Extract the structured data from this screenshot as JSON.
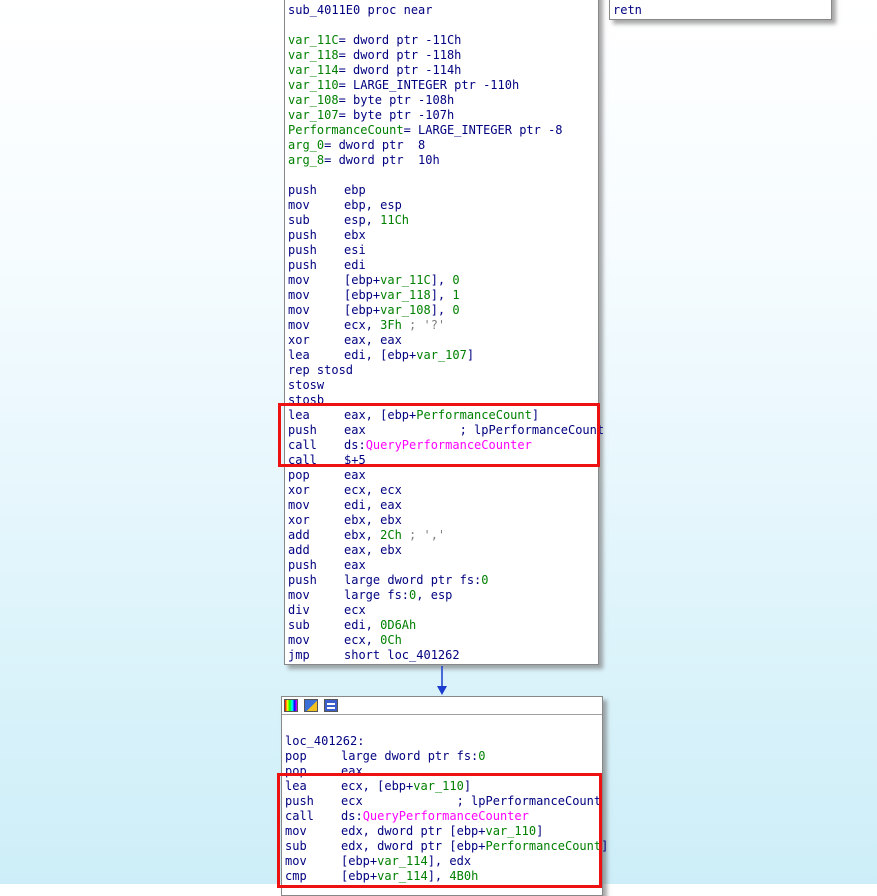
{
  "side_node": {
    "lines": [
      {
        "mnem": "retn",
        "ops": ""
      }
    ]
  },
  "main_node": {
    "header_label": "sub_4011E0 proc near",
    "vars": [
      {
        "name": "var_11C",
        "def": "= dword ptr -11Ch"
      },
      {
        "name": "var_118",
        "def": "= dword ptr -118h"
      },
      {
        "name": "var_114",
        "def": "= dword ptr -114h"
      },
      {
        "name": "var_110",
        "def": "= LARGE_INTEGER ptr -110h"
      },
      {
        "name": "var_108",
        "def": "= byte ptr -108h"
      },
      {
        "name": "var_107",
        "def": "= byte ptr -107h"
      },
      {
        "name": "PerformanceCount",
        "def": "= LARGE_INTEGER ptr -8"
      },
      {
        "name": "arg_0",
        "def": "= dword ptr  8"
      },
      {
        "name": "arg_8",
        "def": "= dword ptr  10h"
      }
    ],
    "instructions": [
      {
        "mnem": "push",
        "parts": [
          {
            "t": "ebp",
            "c": "blu"
          }
        ]
      },
      {
        "mnem": "mov",
        "parts": [
          {
            "t": "ebp, esp",
            "c": "blu"
          }
        ]
      },
      {
        "mnem": "sub",
        "parts": [
          {
            "t": "esp, ",
            "c": "blu"
          },
          {
            "t": "11Ch",
            "c": "grn"
          }
        ]
      },
      {
        "mnem": "push",
        "parts": [
          {
            "t": "ebx",
            "c": "blu"
          }
        ]
      },
      {
        "mnem": "push",
        "parts": [
          {
            "t": "esi",
            "c": "blu"
          }
        ]
      },
      {
        "mnem": "push",
        "parts": [
          {
            "t": "edi",
            "c": "blu"
          }
        ]
      },
      {
        "mnem": "mov",
        "parts": [
          {
            "t": "[ebp+",
            "c": "blu"
          },
          {
            "t": "var_11C",
            "c": "grn"
          },
          {
            "t": "], ",
            "c": "blu"
          },
          {
            "t": "0",
            "c": "grn"
          }
        ]
      },
      {
        "mnem": "mov",
        "parts": [
          {
            "t": "[ebp+",
            "c": "blu"
          },
          {
            "t": "var_118",
            "c": "grn"
          },
          {
            "t": "], ",
            "c": "blu"
          },
          {
            "t": "1",
            "c": "grn"
          }
        ]
      },
      {
        "mnem": "mov",
        "parts": [
          {
            "t": "[ebp+",
            "c": "blu"
          },
          {
            "t": "var_108",
            "c": "grn"
          },
          {
            "t": "], ",
            "c": "blu"
          },
          {
            "t": "0",
            "c": "grn"
          }
        ]
      },
      {
        "mnem": "mov",
        "parts": [
          {
            "t": "ecx, ",
            "c": "blu"
          },
          {
            "t": "3Fh",
            "c": "grn"
          },
          {
            "t": " ; '?'",
            "c": "gry"
          }
        ]
      },
      {
        "mnem": "xor",
        "parts": [
          {
            "t": "eax, eax",
            "c": "blu"
          }
        ]
      },
      {
        "mnem": "lea",
        "parts": [
          {
            "t": "edi, [ebp+",
            "c": "blu"
          },
          {
            "t": "var_107",
            "c": "grn"
          },
          {
            "t": "]",
            "c": "blu"
          }
        ]
      },
      {
        "mnem": "rep stosd",
        "parts": []
      },
      {
        "mnem": "stosw",
        "parts": []
      },
      {
        "mnem": "stosb",
        "parts": []
      },
      {
        "mnem": "lea",
        "parts": [
          {
            "t": "eax, [ebp+",
            "c": "blu"
          },
          {
            "t": "PerformanceCount",
            "c": "grn"
          },
          {
            "t": "]",
            "c": "blu"
          }
        ]
      },
      {
        "mnem": "push",
        "parts": [
          {
            "t": "eax             ; lpPerformanceCount",
            "c": "blu"
          }
        ]
      },
      {
        "mnem": "call",
        "parts": [
          {
            "t": "ds:",
            "c": "blu"
          },
          {
            "t": "QueryPerformanceCounter",
            "c": "mag"
          }
        ]
      },
      {
        "mnem": "call",
        "parts": [
          {
            "t": "$+5",
            "c": "blu"
          }
        ]
      },
      {
        "mnem": "pop",
        "parts": [
          {
            "t": "eax",
            "c": "blu"
          }
        ]
      },
      {
        "mnem": "xor",
        "parts": [
          {
            "t": "ecx, ecx",
            "c": "blu"
          }
        ]
      },
      {
        "mnem": "mov",
        "parts": [
          {
            "t": "edi, eax",
            "c": "blu"
          }
        ]
      },
      {
        "mnem": "xor",
        "parts": [
          {
            "t": "ebx, ebx",
            "c": "blu"
          }
        ]
      },
      {
        "mnem": "add",
        "parts": [
          {
            "t": "ebx, ",
            "c": "blu"
          },
          {
            "t": "2Ch",
            "c": "grn"
          },
          {
            "t": " ; ','",
            "c": "gry"
          }
        ]
      },
      {
        "mnem": "add",
        "parts": [
          {
            "t": "eax, ebx",
            "c": "blu"
          }
        ]
      },
      {
        "mnem": "push",
        "parts": [
          {
            "t": "eax",
            "c": "blu"
          }
        ]
      },
      {
        "mnem": "push",
        "parts": [
          {
            "t": "large dword ptr fs:",
            "c": "blu"
          },
          {
            "t": "0",
            "c": "grn"
          }
        ]
      },
      {
        "mnem": "mov",
        "parts": [
          {
            "t": "large fs:",
            "c": "blu"
          },
          {
            "t": "0",
            "c": "grn"
          },
          {
            "t": ", esp",
            "c": "blu"
          }
        ]
      },
      {
        "mnem": "div",
        "parts": [
          {
            "t": "ecx",
            "c": "blu"
          }
        ]
      },
      {
        "mnem": "sub",
        "parts": [
          {
            "t": "edi, ",
            "c": "blu"
          },
          {
            "t": "0D6Ah",
            "c": "grn"
          }
        ]
      },
      {
        "mnem": "mov",
        "parts": [
          {
            "t": "ecx, ",
            "c": "blu"
          },
          {
            "t": "0Ch",
            "c": "grn"
          }
        ]
      },
      {
        "mnem": "jmp",
        "parts": [
          {
            "t": "short loc_401262",
            "c": "blu"
          }
        ]
      }
    ]
  },
  "second_node": {
    "label": "loc_401262:",
    "header_icons": [
      "color-palette-icon",
      "rename-icon",
      "graph-overview-icon"
    ],
    "instructions": [
      {
        "mnem": "pop",
        "parts": [
          {
            "t": "large dword ptr fs:",
            "c": "blu"
          },
          {
            "t": "0",
            "c": "grn"
          }
        ]
      },
      {
        "mnem": "pop",
        "parts": [
          {
            "t": "eax",
            "c": "blu"
          }
        ]
      },
      {
        "mnem": "lea",
        "parts": [
          {
            "t": "ecx, [ebp+",
            "c": "blu"
          },
          {
            "t": "var_110",
            "c": "grn"
          },
          {
            "t": "]",
            "c": "blu"
          }
        ]
      },
      {
        "mnem": "push",
        "parts": [
          {
            "t": "ecx             ; lpPerformanceCount",
            "c": "blu"
          }
        ]
      },
      {
        "mnem": "call",
        "parts": [
          {
            "t": "ds:",
            "c": "blu"
          },
          {
            "t": "QueryPerformanceCounter",
            "c": "mag"
          }
        ]
      },
      {
        "mnem": "mov",
        "parts": [
          {
            "t": "edx, dword ptr [ebp+",
            "c": "blu"
          },
          {
            "t": "var_110",
            "c": "grn"
          },
          {
            "t": "]",
            "c": "blu"
          }
        ]
      },
      {
        "mnem": "sub",
        "parts": [
          {
            "t": "edx, dword ptr [ebp+",
            "c": "blu"
          },
          {
            "t": "PerformanceCount",
            "c": "grn"
          },
          {
            "t": "]",
            "c": "blu"
          }
        ]
      },
      {
        "mnem": "mov",
        "parts": [
          {
            "t": "[ebp+",
            "c": "blu"
          },
          {
            "t": "var_114",
            "c": "grn"
          },
          {
            "t": "], edx",
            "c": "blu"
          }
        ]
      },
      {
        "mnem": "cmp",
        "parts": [
          {
            "t": "[ebp+",
            "c": "blu"
          },
          {
            "t": "var_114",
            "c": "grn"
          },
          {
            "t": "], ",
            "c": "blu"
          },
          {
            "t": "4B0h",
            "c": "grn"
          }
        ]
      }
    ]
  },
  "colors": {
    "highlight_box": "#ee1111",
    "edge_arrow": "#1a3ccf",
    "label_green": "#008000",
    "mnemonic_navy": "#000080",
    "import_magenta": "#ff00ff"
  }
}
